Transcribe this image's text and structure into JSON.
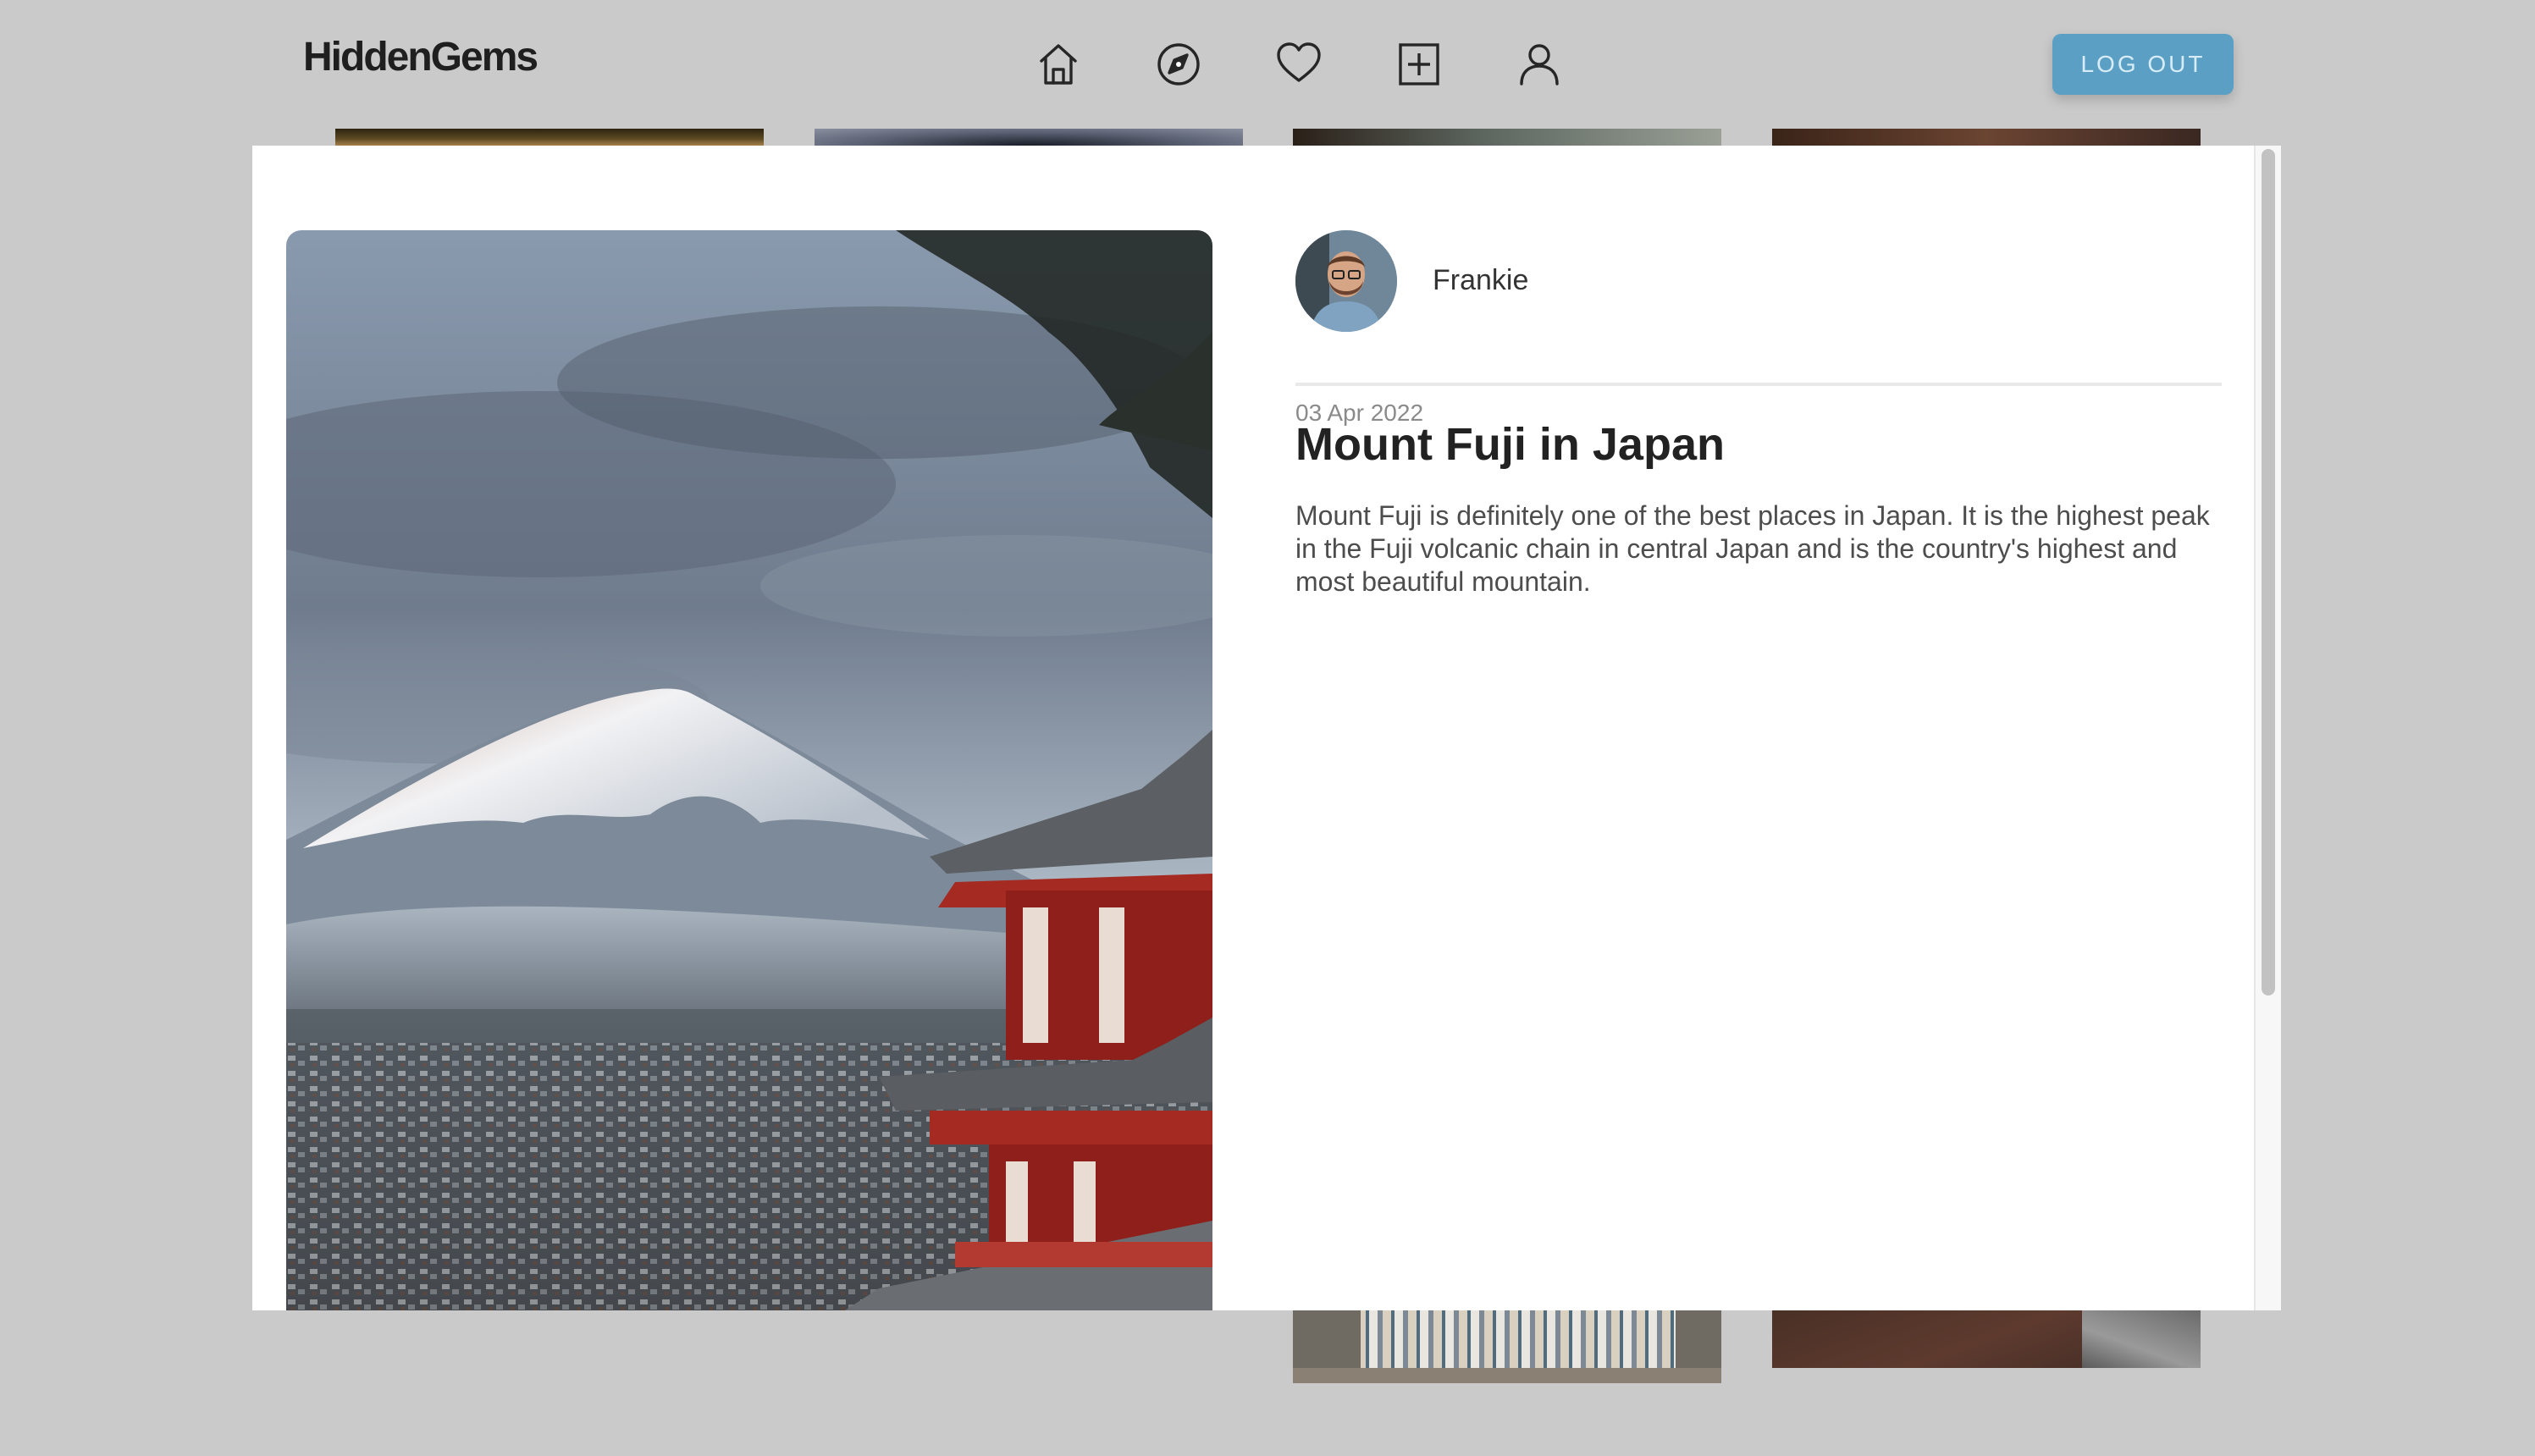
{
  "app": {
    "logo": "HiddenGems"
  },
  "nav": {
    "items": [
      {
        "icon": "home-icon"
      },
      {
        "icon": "compass-icon"
      },
      {
        "icon": "heart-icon"
      },
      {
        "icon": "plus-square-icon"
      },
      {
        "icon": "user-icon"
      }
    ]
  },
  "header": {
    "logout_label": "LOG OUT"
  },
  "post": {
    "author": "Frankie",
    "date": "03 Apr 2022",
    "title": "Mount Fuji in Japan",
    "description": "Mount Fuji is definitely one of the best places in Japan. It is the highest peak in the Fuji volcanic chain in central Japan and is the country's highest and most beautiful mountain."
  },
  "colors": {
    "accent": "#5ba0c4",
    "backdrop": "#cacaca",
    "modal_bg": "#ffffff",
    "title_text": "#222222",
    "body_text": "#4d4d4d",
    "muted_text": "#8a8a8a"
  }
}
